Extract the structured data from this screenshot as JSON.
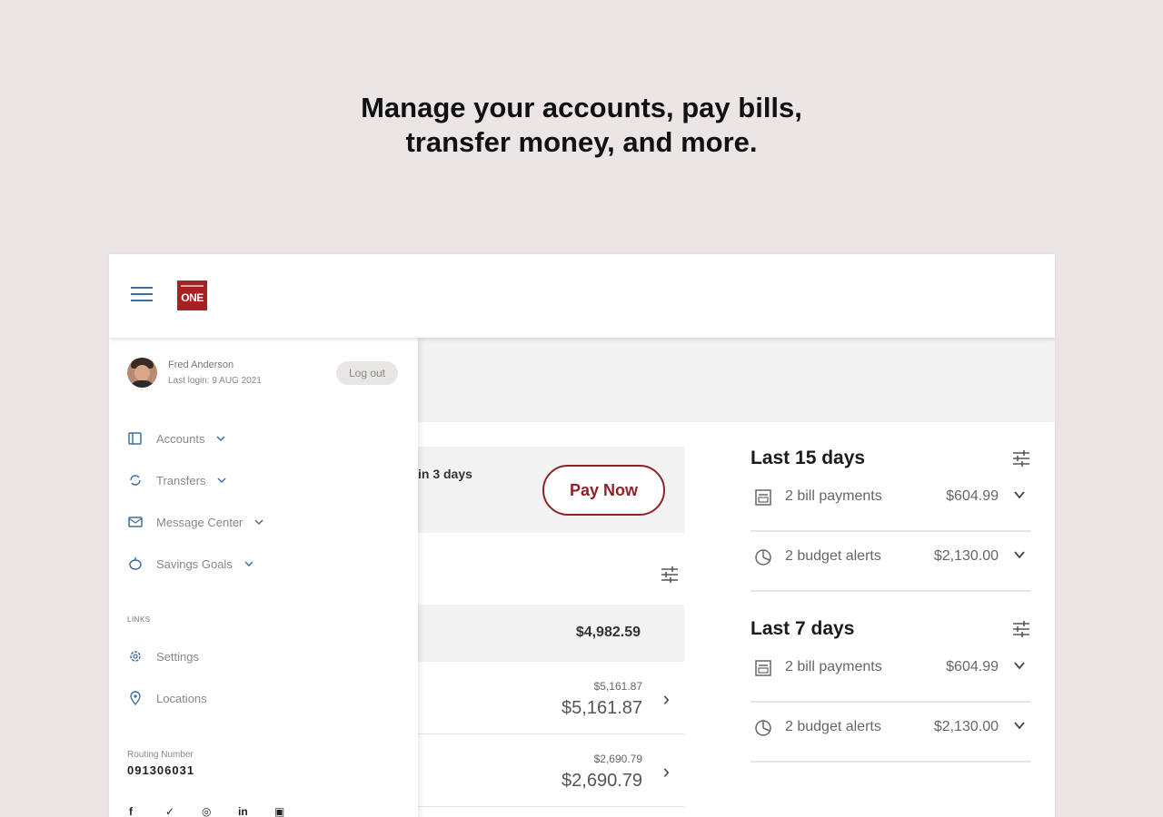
{
  "headline": {
    "line1": "Manage your accounts, pay bills,",
    "line2": "transfer money, and more."
  },
  "app": {
    "logo_text": "ONE",
    "brand_color": "#a81f24",
    "accent_color": "#3f6fa0"
  },
  "drawer": {
    "user_name": "Fred Anderson",
    "last_login": "Last login: 9 AUG 2021",
    "logout_label": "Log out",
    "nav": [
      {
        "label": "Accounts",
        "icon": "accounts-icon"
      },
      {
        "label": "Transfers",
        "icon": "transfers-icon"
      },
      {
        "label": "Message Center",
        "icon": "message-icon"
      },
      {
        "label": "Savings Goals",
        "icon": "savings-icon"
      }
    ],
    "links_header": "LINKS",
    "links": [
      {
        "label": "Settings",
        "icon": "gear-icon"
      },
      {
        "label": "Locations",
        "icon": "location-pin-icon"
      }
    ],
    "routing_label": "Routing Number",
    "routing_number": "091306031",
    "socials": [
      "facebook-icon",
      "twitter-icon",
      "instagram-icon",
      "linkedin-icon",
      "youtube-icon"
    ]
  },
  "main": {
    "bill_due_text": "in 3 days",
    "pay_now_label": "Pay Now",
    "total_amount": "$4,982.59",
    "accounts": [
      {
        "small": "$5,161.87",
        "big": "$5,161.87"
      },
      {
        "small": "$2,690.79",
        "big": "$2,690.79"
      }
    ]
  },
  "summary": [
    {
      "title": "Last 15 days",
      "rows": [
        {
          "label": "2 bill payments",
          "value": "$604.99",
          "icon": "bill-icon"
        },
        {
          "label": "2 budget alerts",
          "value": "$2,130.00",
          "icon": "pie-chart-icon"
        }
      ]
    },
    {
      "title": "Last 7 days",
      "rows": [
        {
          "label": "2 bill payments",
          "value": "$604.99",
          "icon": "bill-icon"
        },
        {
          "label": "2 budget alerts",
          "value": "$2,130.00",
          "icon": "pie-chart-icon"
        }
      ]
    }
  ]
}
